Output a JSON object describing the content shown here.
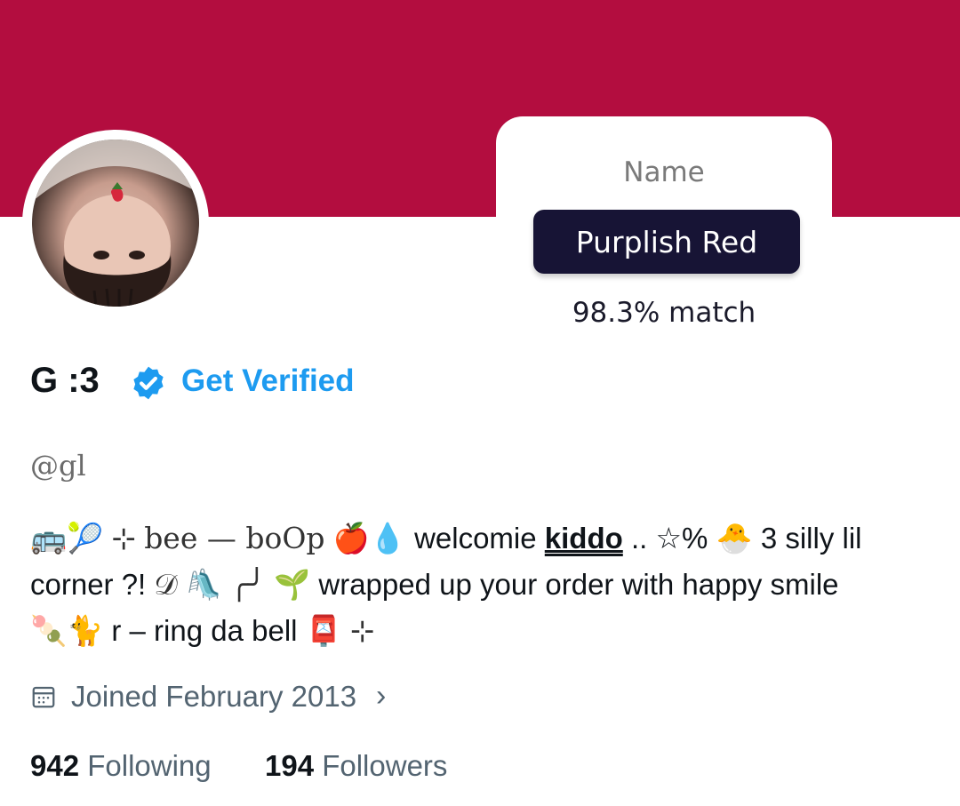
{
  "colors": {
    "banner": "#b30d3f",
    "chip": "#171435",
    "verified": "#1d9bf0"
  },
  "color_card": {
    "label": "Name",
    "value": "Purplish Red",
    "match": "98.3% match"
  },
  "profile": {
    "display_name": "G :3",
    "verified_icon": "verified-badge-icon",
    "get_verified": "Get Verified",
    "handle": "@gl"
  },
  "bio": {
    "line1": {
      "emoji_a": "🚌🎾",
      "ornament_a": "⊹",
      "styled": "bee — boOp",
      "emoji_b": "🍎💧",
      "text_a": "welcomie",
      "kiddo": "kiddo",
      "text_b": ".. ☆%",
      "emoji_c": "🐣",
      "text_c": "3 silly lil"
    },
    "line2": {
      "text_a": "corner ?!",
      "ornament": "𝒟",
      "emoji_a": "🛝",
      "ornament_b": "╭╯",
      "emoji_b": "🌱",
      "text_b": "wrapped up your order with happy smile"
    },
    "line3": {
      "emoji": "🍡🐈",
      "text": "r – ring da bell",
      "emoji_b": "📮",
      "ornament": "⊹"
    }
  },
  "joined": {
    "icon": "calendar-icon",
    "text": "Joined February 2013",
    "chevron": "›"
  },
  "stats": {
    "following_count": "942",
    "following_label": "Following",
    "followers_count": "194",
    "followers_label": "Followers"
  }
}
